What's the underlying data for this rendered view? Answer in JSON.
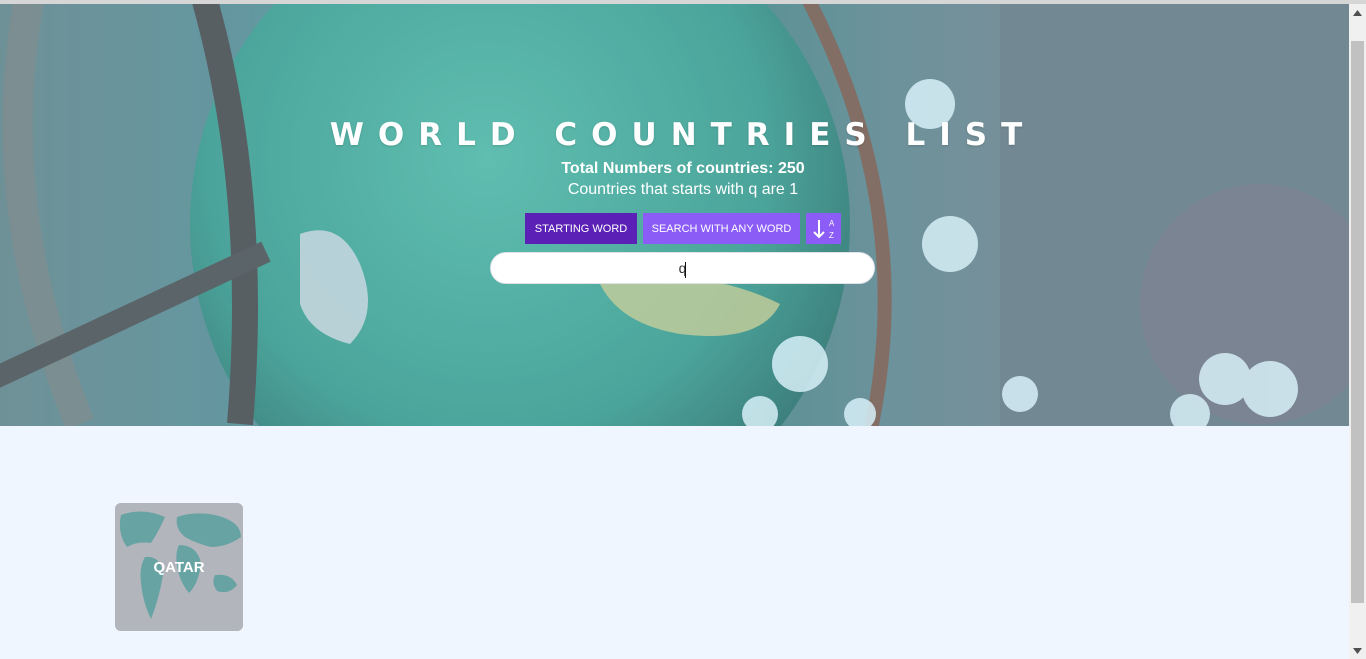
{
  "header": {
    "title": "WORLD COUNTRIES LIST",
    "total": "Total Numbers of countries: 250",
    "starts_with": "Countries that starts with q are 1"
  },
  "controls": {
    "starting_word_label": "STARTING WORD",
    "any_word_label": "SEARCH WITH ANY WORD",
    "sort_icon": "sort-alpha-down-icon"
  },
  "search": {
    "value": "q",
    "placeholder": ""
  },
  "countries": [
    {
      "name": "QATAR"
    }
  ],
  "colors": {
    "starting_word_button": "#5b21b6",
    "any_word_button": "#8b5cf6",
    "page_background": "#eff6ff"
  }
}
